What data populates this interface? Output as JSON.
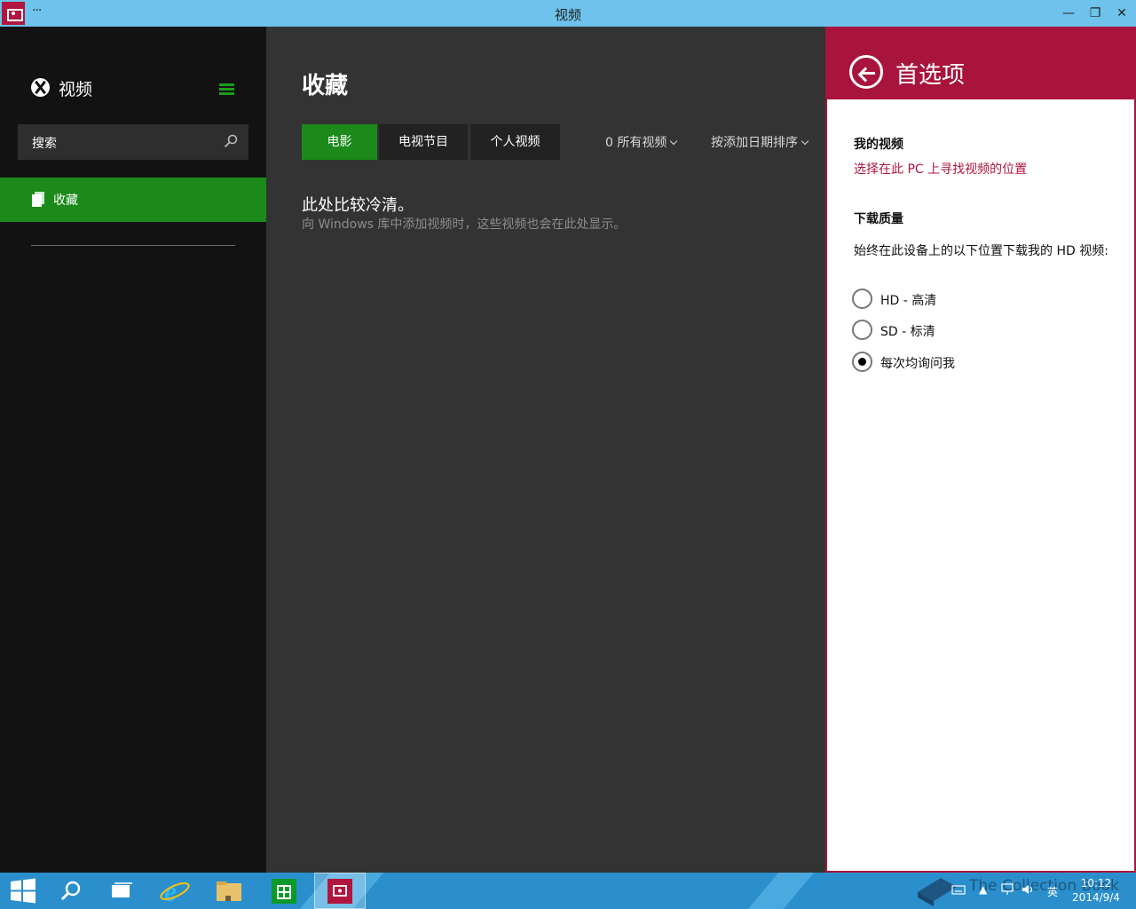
{
  "window": {
    "title": "视频",
    "more_label": "···",
    "minimize_label": "—",
    "restore_label": "❐",
    "close_label": "✕"
  },
  "nav": {
    "app_name": "视频",
    "search_placeholder": "搜索",
    "items": [
      {
        "label": "收藏"
      }
    ]
  },
  "main": {
    "heading": "收藏",
    "tabs": [
      {
        "label": "电影",
        "active": true
      },
      {
        "label": "电视节目",
        "active": false
      },
      {
        "label": "个人视频",
        "active": false
      }
    ],
    "filter_count": "0 所有视频",
    "sort_label": "按添加日期排序",
    "empty_title": "此处比较冷清。",
    "empty_desc": "向 Windows 库中添加视频时，这些视频也会在此处显示。"
  },
  "preferences": {
    "title": "首选项",
    "my_videos_label": "我的视频",
    "my_videos_link": "选择在此 PC 上寻找视频的位置",
    "download_quality_label": "下载质量",
    "download_desc": "始终在此设备上的以下位置下载我的 HD 视频:",
    "options": [
      {
        "label": "HD - 高清",
        "checked": false
      },
      {
        "label": "SD - 标清",
        "checked": false
      },
      {
        "label": "每次均询问我",
        "checked": true
      }
    ]
  },
  "taskbar": {
    "time": "10:12",
    "date": "2014/9/4",
    "ime_label": "英",
    "watermark": "The Collection Book"
  },
  "colors": {
    "accent_green": "#1b8a1b",
    "accent_crimson": "#a8143b",
    "titlebar": "#6ec2ec",
    "taskbar": "#2a8fcc"
  }
}
